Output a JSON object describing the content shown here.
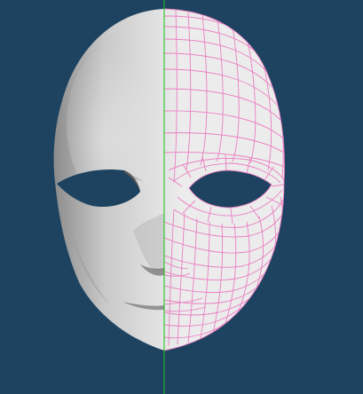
{
  "viewport": {
    "background_color": "#1d4360",
    "symmetry_axis_color": "#19c519",
    "wireframe_color": "#ea7fc2",
    "mask_shade_light": "#ececec",
    "mask_shade_mid": "#c9c9c9",
    "mask_shade_dark": "#8c8c8c"
  },
  "scene": {
    "object": "face-mask-mesh",
    "left_half_display": "smooth-shaded",
    "right_half_display": "shaded-with-wireframe"
  }
}
